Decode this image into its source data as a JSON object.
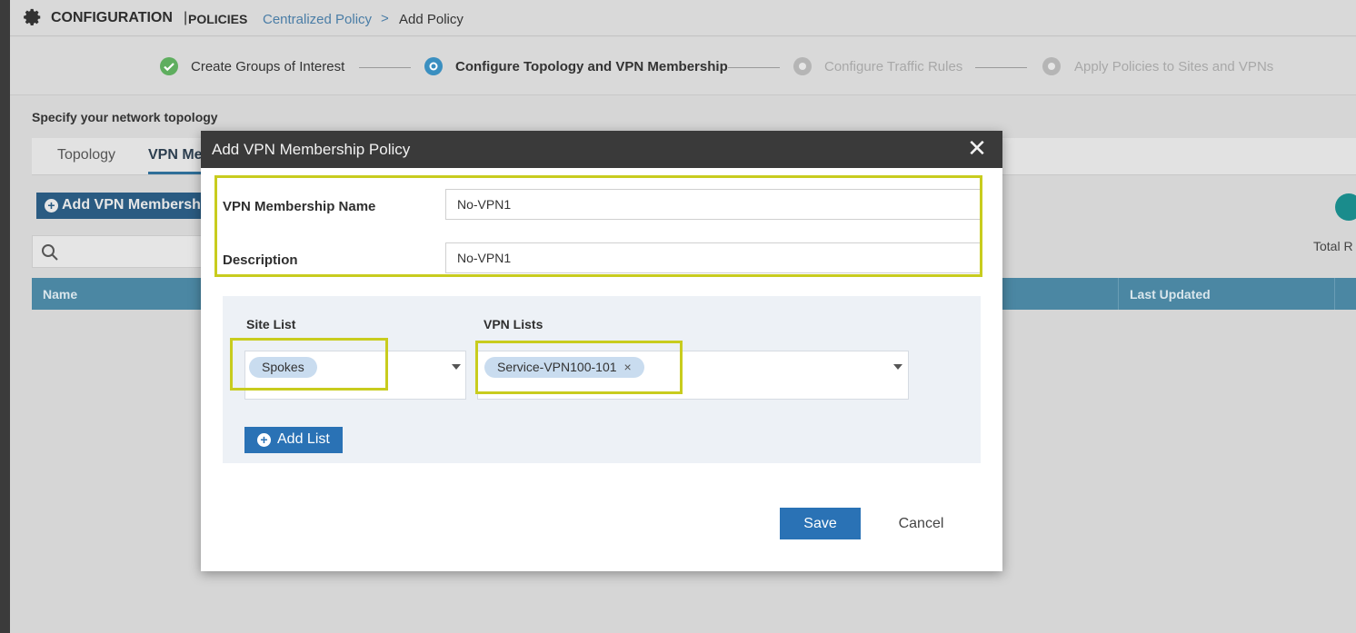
{
  "header": {
    "title": "CONFIGURATION",
    "separator": "|",
    "subtitle": "POLICIES",
    "breadcrumb_link": "Centralized Policy",
    "breadcrumb_sep": ">",
    "breadcrumb_current": "Add Policy",
    "icon": "gear-icon"
  },
  "steps": [
    {
      "label": "Create Groups of Interest",
      "state": "done"
    },
    {
      "label": "Configure Topology and VPN Membership",
      "state": "current"
    },
    {
      "label": "Configure Traffic Rules",
      "state": "pending"
    },
    {
      "label": "Apply Policies to Sites and VPNs",
      "state": "pending"
    }
  ],
  "specify_text": "Specify your network topology",
  "tabs": [
    {
      "label": "Topology",
      "active": false
    },
    {
      "label": "VPN Me",
      "active": true
    }
  ],
  "toolbar": {
    "add_label": "Add VPN Membersh",
    "total_label": "Total R"
  },
  "table": {
    "columns": [
      "Name",
      "Last Updated"
    ]
  },
  "modal": {
    "title": "Add VPN Membership Policy",
    "close_glyph": "✕",
    "name_label": "VPN Membership Name",
    "name_value": "No-VPN1",
    "description_label": "Description",
    "description_value": "No-VPN1",
    "site_list_label": "Site List",
    "site_list_chips": [
      "Spokes"
    ],
    "vpn_lists_label": "VPN Lists",
    "vpn_lists_chips": [
      "Service-VPN100-101"
    ],
    "chip_remove_glyph": "×",
    "add_list_label": "Add List",
    "save_label": "Save",
    "cancel_label": "Cancel"
  },
  "colors": {
    "highlight": "#c8cc1e",
    "primary_button": "#2a72b5",
    "table_header": "#4b87a3",
    "chip": "#c9dcef",
    "step_done": "#4caf50",
    "step_current": "#2f8fc4"
  }
}
